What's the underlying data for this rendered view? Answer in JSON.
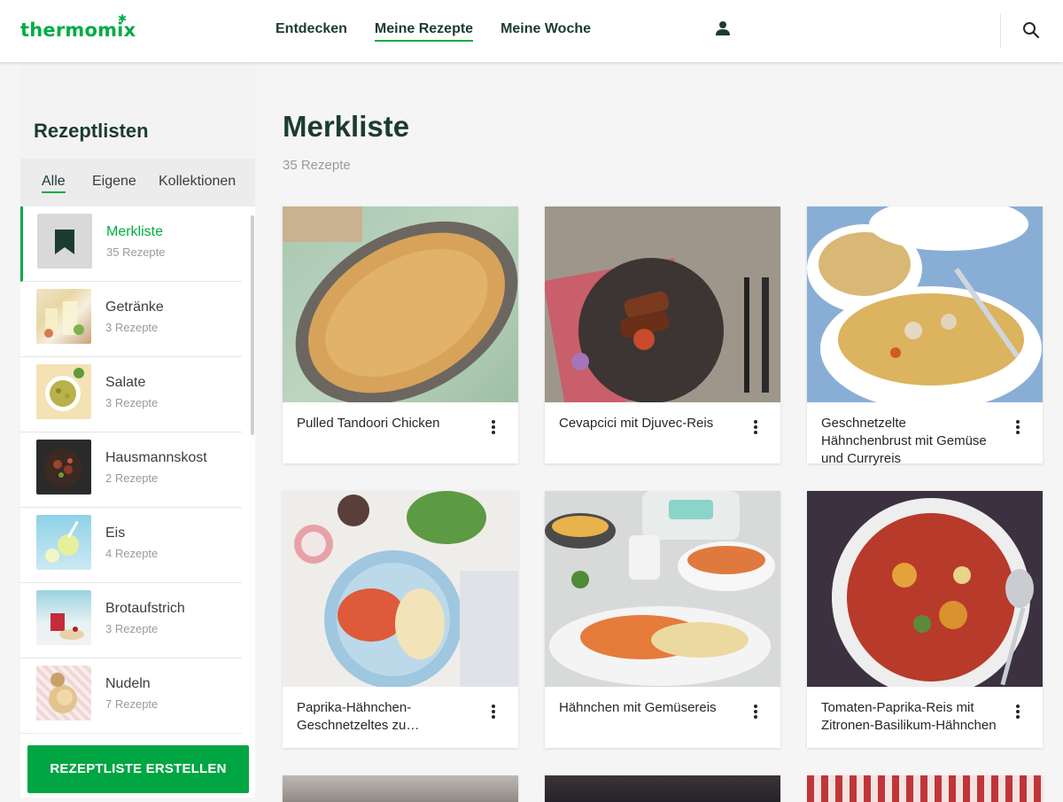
{
  "header": {
    "logo": "thermomix",
    "nav": [
      "Entdecken",
      "Meine Rezepte",
      "Meine Woche"
    ],
    "active_nav": "Meine Rezepte",
    "icons": [
      "user-icon",
      "search-icon"
    ]
  },
  "sidebar": {
    "title": "Rezeptlisten",
    "tabs": [
      "Alle",
      "Eigene",
      "Kollektionen"
    ],
    "active_tab": "Alle",
    "items": [
      {
        "label": "Merkliste",
        "count": "35 Rezepte",
        "icon": "bookmark-icon"
      },
      {
        "label": "Getränke",
        "count": "3 Rezepte"
      },
      {
        "label": "Salate",
        "count": "3 Rezepte"
      },
      {
        "label": "Hausmannskost",
        "count": "2 Rezepte"
      },
      {
        "label": "Eis",
        "count": "4 Rezepte"
      },
      {
        "label": "Brotaufstrich",
        "count": "3 Rezepte"
      },
      {
        "label": "Nudeln",
        "count": "7 Rezepte"
      }
    ],
    "create_button": "REZEPTLISTE ERSTELLEN"
  },
  "main": {
    "title": "Merkliste",
    "count": "35 Rezepte",
    "cards": [
      {
        "title": "Pulled Tandoori Chicken"
      },
      {
        "title": "Cevapcici mit Djuvec-Reis"
      },
      {
        "title": "Geschnetzelte Hähnchenbrust mit Gemüse und Curryreis"
      },
      {
        "title": "Paprika-Hähnchen-Geschnetzeltes zu…"
      },
      {
        "title": "Hähnchen mit Gemüsereis"
      },
      {
        "title": "Tomaten-Paprika-Reis mit Zitronen-Basilikum-Hähnchen"
      }
    ]
  },
  "colors": {
    "brand_green": "#00ac46",
    "dark_text": "#1c3b32",
    "muted_text": "#9a9a9a"
  }
}
